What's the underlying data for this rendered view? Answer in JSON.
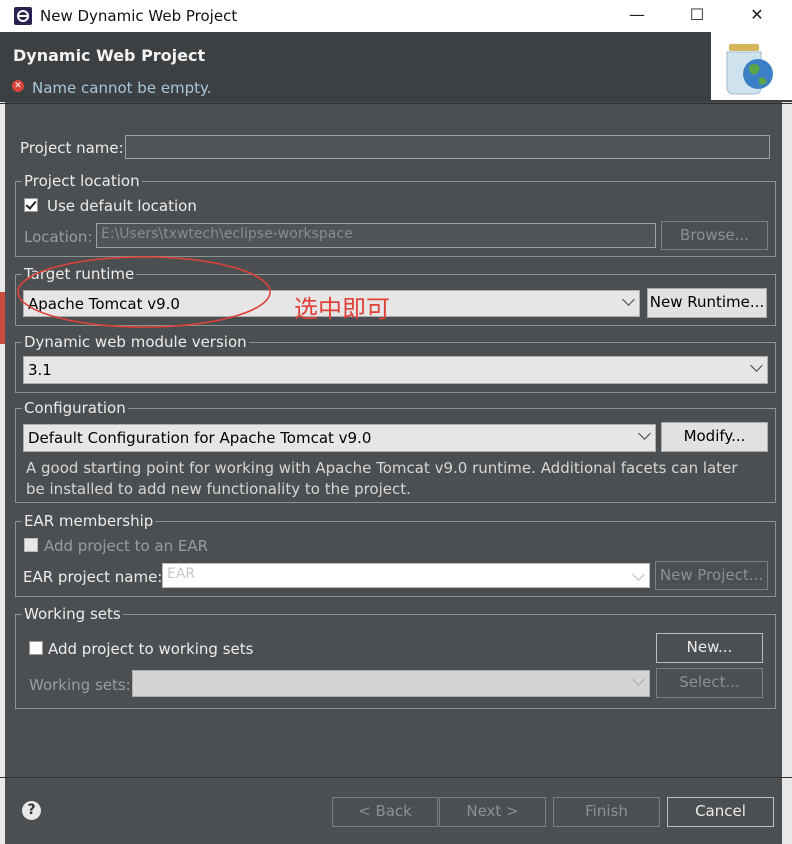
{
  "window": {
    "title": "New Dynamic Web Project",
    "minimize": "—",
    "maximize": "☐",
    "close": "✕"
  },
  "header": {
    "title": "Dynamic Web Project",
    "message": "Name cannot be empty.",
    "error_icon": "✕"
  },
  "project_name": {
    "label": "Project name:",
    "value": ""
  },
  "project_location": {
    "group_title": "Project location",
    "use_default": {
      "label": "Use default location",
      "checked": true
    },
    "location_label": "Location:",
    "location_value": "E:\\Users\\txwtech\\eclipse-workspace",
    "browse": "Browse..."
  },
  "target_runtime": {
    "group_title": "Target runtime",
    "selected": "Apache Tomcat v9.0",
    "new_runtime": "New Runtime...",
    "annotation": "选中即可"
  },
  "web_module": {
    "group_title": "Dynamic web module version",
    "selected": "3.1"
  },
  "configuration": {
    "group_title": "Configuration",
    "selected": "Default Configuration for Apache Tomcat v9.0",
    "modify": "Modify...",
    "description": "A good starting point for working with Apache Tomcat v9.0 runtime. Additional facets can later be installed to add new functionality to the project."
  },
  "ear": {
    "group_title": "EAR membership",
    "add_label": "Add project to an EAR",
    "name_label": "EAR project name:",
    "name_value": "EAR",
    "new_project": "New Project..."
  },
  "working_sets": {
    "group_title": "Working sets",
    "add_label": "Add project to working sets",
    "new": "New...",
    "sets_label": "Working sets:",
    "select": "Select..."
  },
  "footer": {
    "help": "?",
    "back": "< Back",
    "next": "Next >",
    "finish": "Finish",
    "cancel": "Cancel"
  },
  "colors": {
    "background": "#4b4f52",
    "header": "#3d4043",
    "error": "#d9453b",
    "annotation": "#e0403a"
  }
}
